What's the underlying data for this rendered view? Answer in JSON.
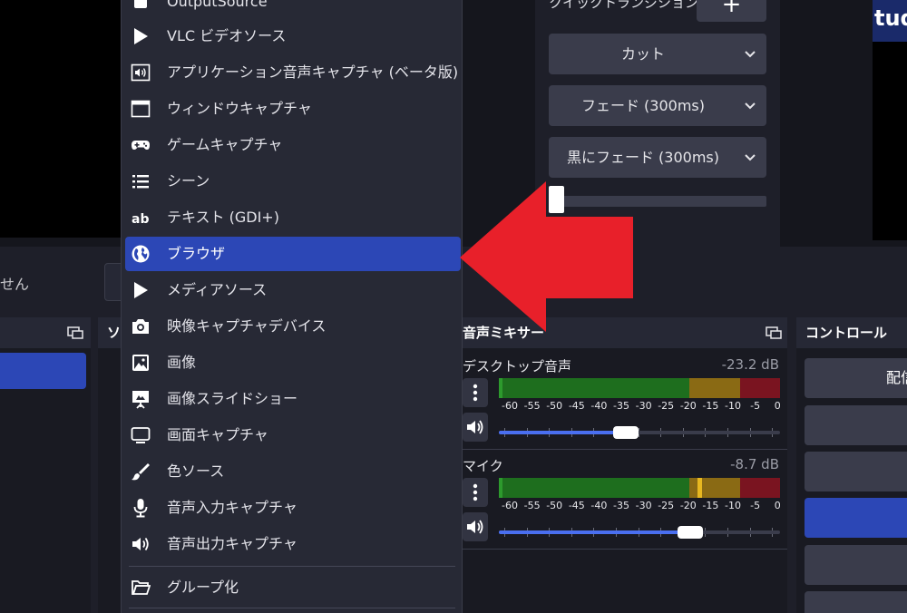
{
  "transitions": {
    "quick_label": "クイックトランジション",
    "add_label": "+",
    "items": [
      "カット",
      "フェード (300ms)",
      "黒にフェード (300ms)"
    ]
  },
  "preview": {
    "right_text": "tud"
  },
  "status": {
    "partial_text": "せん"
  },
  "docks": {
    "scenes_title": "",
    "sources_title": "ソ",
    "mixer_title": "音声ミキサー",
    "controls_title": "コントロール"
  },
  "menu": {
    "items": [
      {
        "label": "OutputSource",
        "icon": "output-source-icon"
      },
      {
        "label": "VLC ビデオソース",
        "icon": "play-icon"
      },
      {
        "label": "アプリケーション音声キャプチャ (ベータ版)",
        "icon": "app-audio-icon"
      },
      {
        "label": "ウィンドウキャプチャ",
        "icon": "window-icon"
      },
      {
        "label": "ゲームキャプチャ",
        "icon": "gamepad-icon"
      },
      {
        "label": "シーン",
        "icon": "list-icon"
      },
      {
        "label": "テキスト (GDI+)",
        "icon": "text-ab-icon"
      },
      {
        "label": "ブラウザ",
        "icon": "globe-icon",
        "selected": true
      },
      {
        "label": "メディアソース",
        "icon": "play-icon"
      },
      {
        "label": "映像キャプチャデバイス",
        "icon": "camera-icon"
      },
      {
        "label": "画像",
        "icon": "image-icon"
      },
      {
        "label": "画像スライドショー",
        "icon": "slideshow-icon"
      },
      {
        "label": "画面キャプチャ",
        "icon": "monitor-icon"
      },
      {
        "label": "色ソース",
        "icon": "brush-icon"
      },
      {
        "label": "音声入力キャプチャ",
        "icon": "microphone-icon"
      },
      {
        "label": "音声出力キャプチャ",
        "icon": "speaker-icon"
      }
    ],
    "group_label": "グループ化"
  },
  "mixer": {
    "scale": [
      "-60",
      "-55",
      "-50",
      "-45",
      "-40",
      "-35",
      "-30",
      "-25",
      "-20",
      "-15",
      "-10",
      "-5",
      "0"
    ],
    "channels": [
      {
        "name": "デスクトップ音声",
        "db": "-23.2 dB",
        "volume": 0.45
      },
      {
        "name": "マイク",
        "db": "-8.7 dB",
        "volume": 0.68
      }
    ]
  },
  "controls": {
    "start_streaming_label": "配信"
  },
  "colors": {
    "accent": "#2c47b6",
    "arrow": "#e8202a",
    "meter_green": "#1e6e1e",
    "meter_yellow": "#8a6a14",
    "meter_red": "#7a1420"
  }
}
